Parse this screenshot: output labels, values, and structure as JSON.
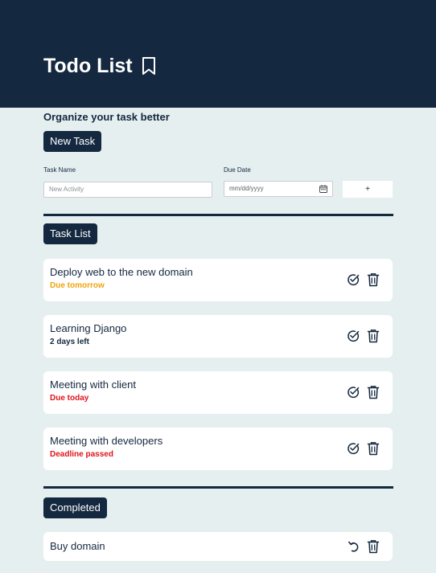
{
  "header": {
    "title": "Todo List",
    "bookmark_icon": "bookmark-icon",
    "background": "#142840"
  },
  "subtitle": "Organize your task better",
  "new_task": {
    "button_label": "New Task",
    "task_name_label": "Task Name",
    "task_name_placeholder": "New Activity",
    "due_date_label": "Due Date",
    "due_date_placeholder": "mm/dd/yyyy",
    "calendar_icon": "calendar-icon",
    "add_label": "+"
  },
  "task_list": {
    "label": "Task List",
    "items": [
      {
        "name": "Deploy web to the new domain",
        "due": "Due tomorrow",
        "due_color": "#f0a30a"
      },
      {
        "name": "Learning Django",
        "due": "2 days left",
        "due_color": "#14283f"
      },
      {
        "name": "Meeting with client",
        "due": "Due today",
        "due_color": "#e0131b"
      },
      {
        "name": "Meeting with developers",
        "due": "Deadline passed",
        "due_color": "#e0131b"
      }
    ]
  },
  "completed": {
    "label": "Completed",
    "items": [
      {
        "name": "Buy domain"
      }
    ]
  },
  "colors": {
    "accent": "#142840",
    "background": "#e5eff0",
    "warning": "#f0a30a",
    "danger": "#e0131b"
  }
}
